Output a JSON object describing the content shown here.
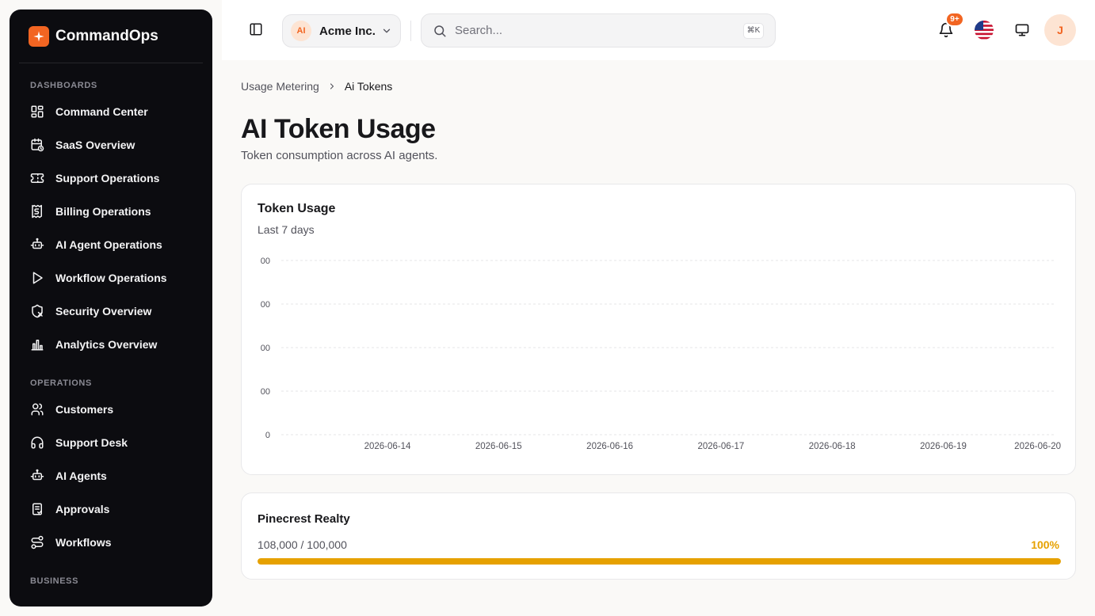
{
  "brand": {
    "name": "CommandOps",
    "accent": "#f26522"
  },
  "sidebar": {
    "groups": [
      {
        "label": "DASHBOARDS",
        "items": [
          {
            "label": "Command Center",
            "icon": "layout-dashboard-icon"
          },
          {
            "label": "SaaS Overview",
            "icon": "calendar-clock-icon"
          },
          {
            "label": "Support Operations",
            "icon": "ticket-icon"
          },
          {
            "label": "Billing Operations",
            "icon": "receipt-icon"
          },
          {
            "label": "AI Agent Operations",
            "icon": "bot-icon"
          },
          {
            "label": "Workflow Operations",
            "icon": "play-icon"
          },
          {
            "label": "Security Overview",
            "icon": "shield-x-icon"
          },
          {
            "label": "Analytics Overview",
            "icon": "bar-chart-icon"
          }
        ]
      },
      {
        "label": "OPERATIONS",
        "items": [
          {
            "label": "Customers",
            "icon": "users-icon"
          },
          {
            "label": "Support Desk",
            "icon": "headphones-icon"
          },
          {
            "label": "AI Agents",
            "icon": "bot-icon"
          },
          {
            "label": "Approvals",
            "icon": "clipboard-check-icon"
          },
          {
            "label": "Workflows",
            "icon": "route-icon"
          }
        ]
      },
      {
        "label": "BUSINESS",
        "items": []
      }
    ]
  },
  "topbar": {
    "org": {
      "initials": "AI",
      "name": "Acme Inc."
    },
    "search": {
      "placeholder": "Search...",
      "shortcut": "⌘K"
    },
    "notifications": {
      "badge": "9+"
    },
    "user": {
      "initial": "J"
    }
  },
  "breadcrumb": {
    "parent": "Usage Metering",
    "current": "Ai Tokens"
  },
  "page": {
    "title": "AI Token Usage",
    "subtitle": "Token consumption across AI agents."
  },
  "chart_card": {
    "title": "Token Usage",
    "subtitle": "Last 7 days"
  },
  "chart_data": {
    "type": "line",
    "title": "Token Usage",
    "subtitle": "Last 7 days",
    "x": [
      "2026-06-14",
      "2026-06-15",
      "2026-06-16",
      "2026-06-17",
      "2026-06-18",
      "2026-06-19",
      "2026-06-20"
    ],
    "y_ticks": [
      "0",
      "00",
      "00",
      "00",
      "00"
    ],
    "series": [],
    "grid": true,
    "colors": {
      "grid": "#e4e4e7",
      "tick": "#52525b"
    }
  },
  "quota": {
    "name": "Pinecrest Realty",
    "usage": "108,000 / 100,000",
    "percent_label": "100%",
    "fill_fraction": 1.0,
    "color": "#e6a100"
  }
}
